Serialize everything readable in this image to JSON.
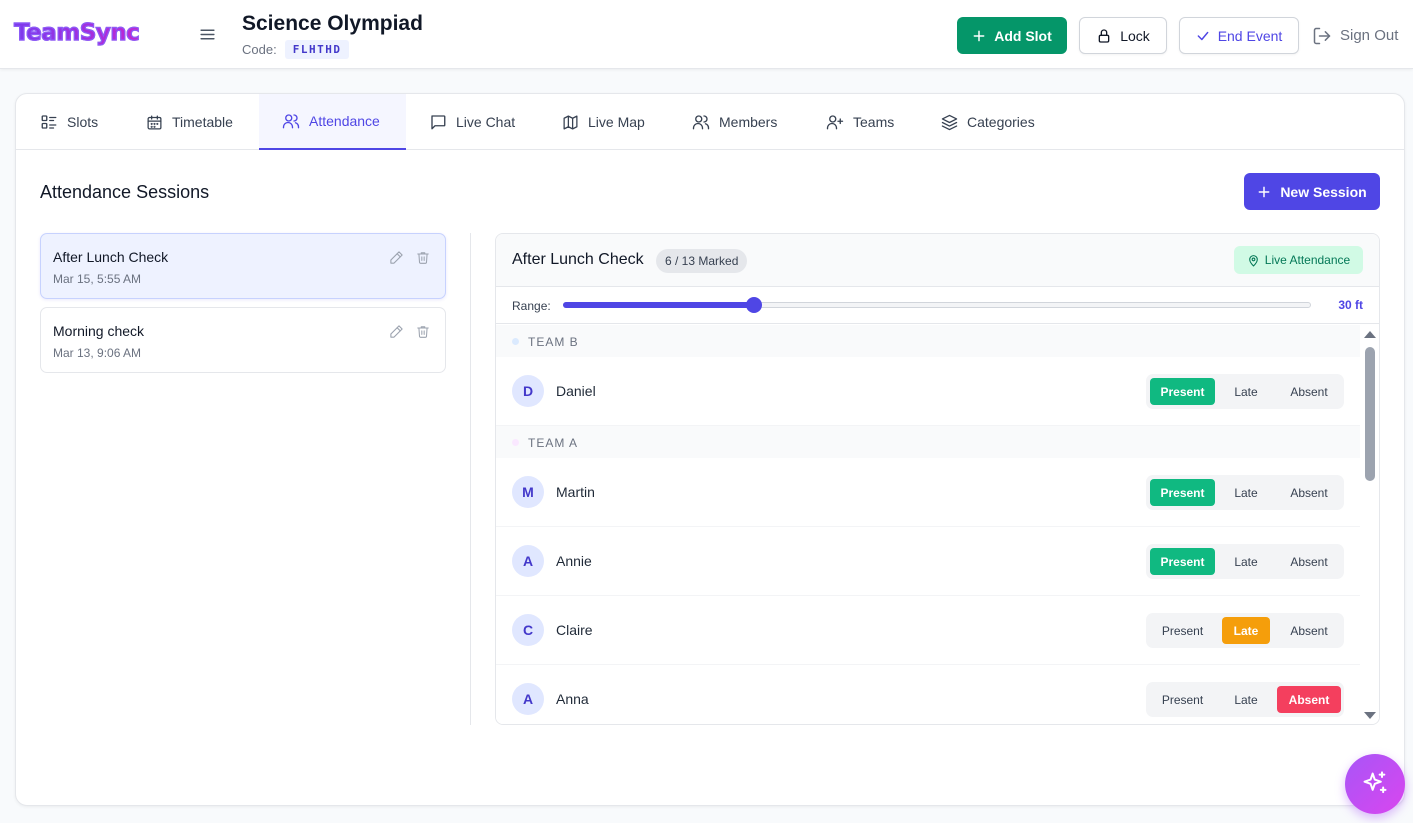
{
  "app": {
    "logo": "TeamSync"
  },
  "event": {
    "title": "Science Olympiad",
    "code_label": "Code:",
    "code": "FLHTHD"
  },
  "header": {
    "add_slot": "Add Slot",
    "lock": "Lock",
    "end_event": "End Event",
    "sign_out": "Sign Out"
  },
  "tabs": [
    {
      "label": "Slots",
      "icon": "list-icon"
    },
    {
      "label": "Timetable",
      "icon": "calendar-icon"
    },
    {
      "label": "Attendance",
      "icon": "users-icon",
      "active": true
    },
    {
      "label": "Live Chat",
      "icon": "chat-icon"
    },
    {
      "label": "Live Map",
      "icon": "map-icon"
    },
    {
      "label": "Members",
      "icon": "users-icon"
    },
    {
      "label": "Teams",
      "icon": "user-plus-icon"
    },
    {
      "label": "Categories",
      "icon": "layers-icon"
    }
  ],
  "attendance": {
    "title": "Attendance Sessions",
    "new_session": "New Session",
    "sessions": [
      {
        "name": "After Lunch Check",
        "date": "Mar 15, 5:55 AM",
        "selected": true
      },
      {
        "name": "Morning check",
        "date": "Mar 13, 9:06 AM",
        "selected": false
      }
    ]
  },
  "panel": {
    "title": "After Lunch Check",
    "marked": "6 / 13 Marked",
    "live": "Live Attendance",
    "range_label": "Range:",
    "range_value": "30 ft",
    "range_fraction": 0.255,
    "status_labels": {
      "present": "Present",
      "late": "Late",
      "absent": "Absent"
    },
    "teams": [
      {
        "name": "TEAM B",
        "dot_color": "#dbeafe",
        "members": [
          {
            "initial": "D",
            "name": "Daniel",
            "status": "present"
          }
        ]
      },
      {
        "name": "TEAM A",
        "dot_color": "#fae8ff",
        "members": [
          {
            "initial": "M",
            "name": "Martin",
            "status": "present"
          },
          {
            "initial": "A",
            "name": "Annie",
            "status": "present"
          },
          {
            "initial": "C",
            "name": "Claire",
            "status": "late"
          },
          {
            "initial": "A",
            "name": "Anna",
            "status": "absent"
          }
        ]
      }
    ]
  },
  "colors": {
    "primary": "#4f46e5",
    "success": "#059669",
    "present": "#10b981",
    "late": "#f59e0b",
    "absent": "#f43f5e"
  }
}
